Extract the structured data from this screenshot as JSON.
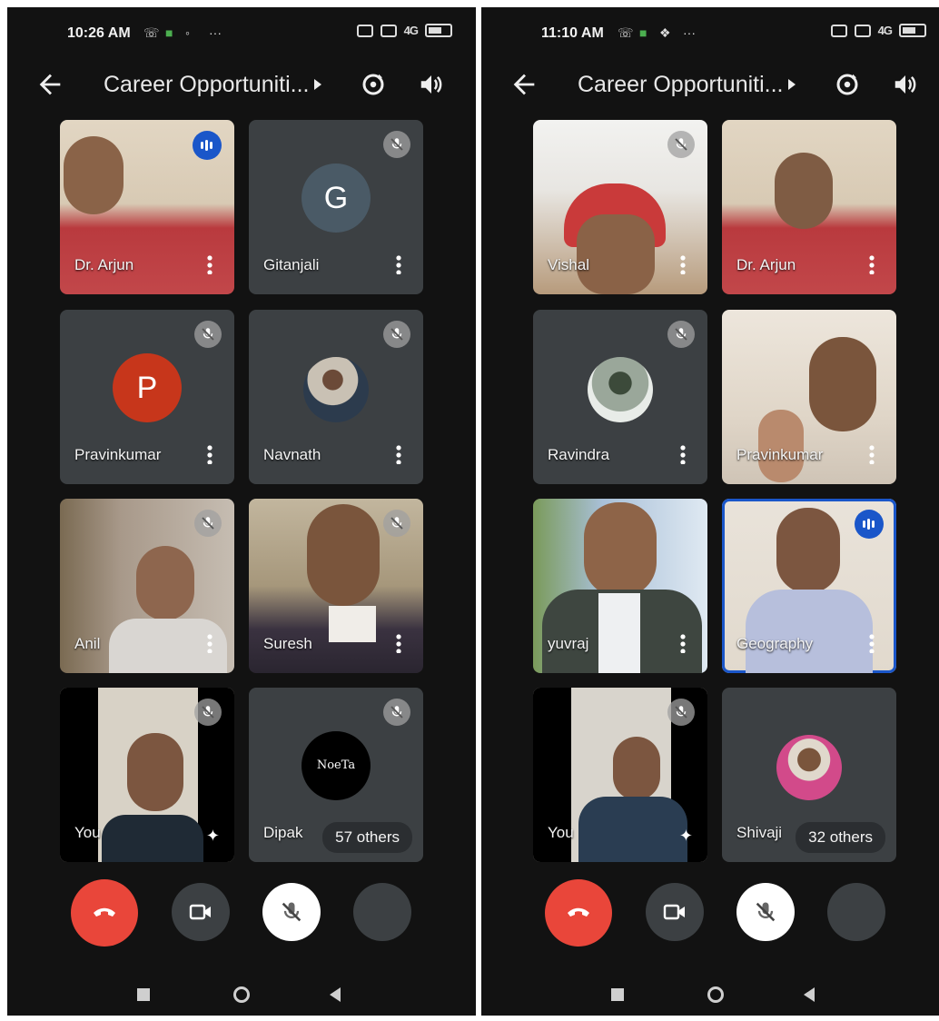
{
  "screens": [
    {
      "status": {
        "time": "10:26 AM",
        "more": "···",
        "signal": "4G"
      },
      "header": {
        "title": "Career Opportuniti..."
      },
      "tiles": [
        {
          "name": "Dr. Arjun",
          "state": "speaking",
          "bg": "video-red-shirt"
        },
        {
          "name": "Gitanjali",
          "state": "muted",
          "initial": "G",
          "avatar_color": "#4a5a66"
        },
        {
          "name": "Pravinkumar",
          "state": "muted",
          "initial": "P",
          "avatar_color": "#c7361b"
        },
        {
          "name": "Navnath",
          "state": "muted",
          "bg": "photo-avatar"
        },
        {
          "name": "Anil",
          "state": "muted",
          "bg": "video"
        },
        {
          "name": "Suresh",
          "state": "muted",
          "bg": "video"
        },
        {
          "name": "You",
          "state": "muted",
          "bg": "self-video"
        },
        {
          "name": "Dipak",
          "state": "muted",
          "logo_text": "NoeTa",
          "others": "57 others"
        }
      ]
    },
    {
      "status": {
        "time": "11:10 AM",
        "more": "···",
        "signal": "4G"
      },
      "header": {
        "title": "Career Opportuniti..."
      },
      "tiles": [
        {
          "name": "Vishal",
          "state": "muted",
          "bg": "video"
        },
        {
          "name": "Dr. Arjun",
          "state": "none",
          "bg": "video-red-shirt"
        },
        {
          "name": "Ravindra",
          "state": "muted",
          "bg": "photo-avatar"
        },
        {
          "name": "Pravinkumar",
          "state": "none",
          "bg": "video"
        },
        {
          "name": "yuvraj",
          "state": "none",
          "bg": "video"
        },
        {
          "name": "Geography",
          "state": "speaking",
          "bg": "video"
        },
        {
          "name": "You",
          "state": "muted",
          "bg": "self-video"
        },
        {
          "name": "Shivaji",
          "state": "none",
          "bg": "photo-avatar",
          "others": "32 others"
        }
      ]
    }
  ],
  "controls": [
    "end-call",
    "camera",
    "microphone-muted",
    "more-options"
  ],
  "colors": {
    "end_call": "#e9463a",
    "speaking_accent": "#1a56c9",
    "background": "#121212",
    "tile": "#3c4043"
  }
}
